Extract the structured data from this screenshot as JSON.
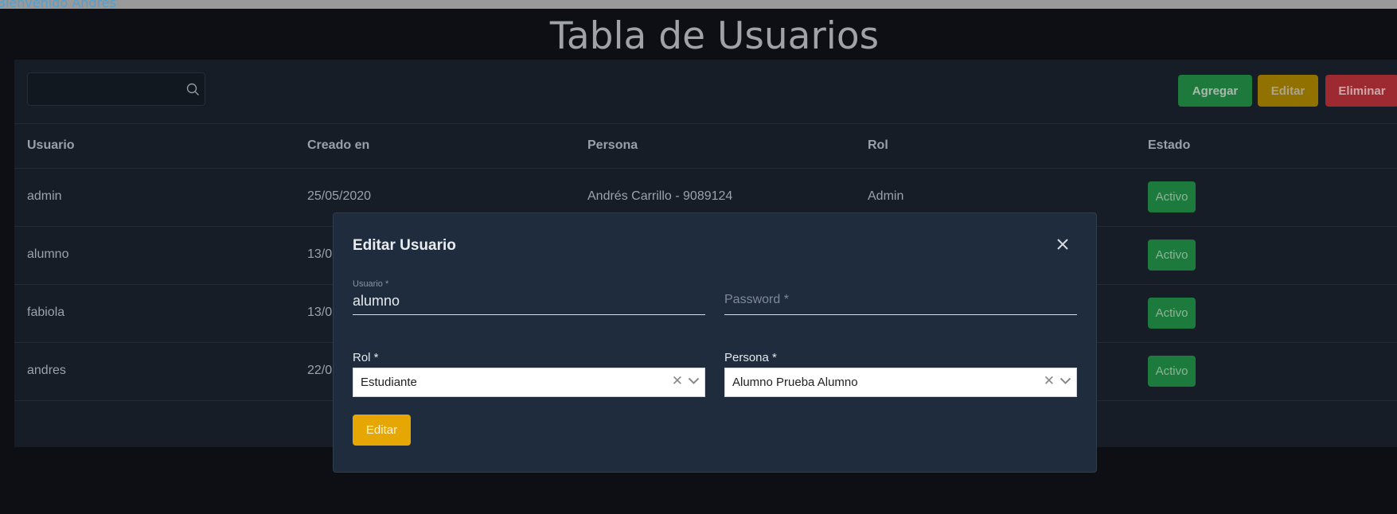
{
  "topbar": {
    "text": "Bienvenido Andres"
  },
  "page": {
    "title": "Tabla de Usuarios"
  },
  "toolbar": {
    "search_placeholder": "",
    "add_label": "Agregar",
    "edit_label": "Editar",
    "delete_label": "Eliminar"
  },
  "table": {
    "headers": {
      "usuario": "Usuario",
      "creado": "Creado en",
      "persona": "Persona",
      "rol": "Rol",
      "estado": "Estado"
    },
    "rows": [
      {
        "usuario": "admin",
        "creado": "25/05/2020",
        "persona": "Andrés Carrillo - 9089124",
        "rol": "Admin",
        "estado": "Activo"
      },
      {
        "usuario": "alumno",
        "creado": "13/0",
        "persona": "",
        "rol": "",
        "estado": "Activo"
      },
      {
        "usuario": "fabiola",
        "creado": "13/0",
        "persona": "",
        "rol": "",
        "estado": "Activo"
      },
      {
        "usuario": "andres",
        "creado": "22/0",
        "persona": "",
        "rol": "",
        "estado": "Activo"
      }
    ]
  },
  "modal": {
    "title": "Editar Usuario",
    "usuario_label": "Usuario *",
    "usuario_value": "alumno",
    "password_placeholder": "Password *",
    "rol_label": "Rol *",
    "rol_value": "Estudiante",
    "persona_label": "Persona *",
    "persona_value": "Alumno Prueba Alumno",
    "submit_label": "Editar"
  },
  "colors": {
    "background": "#0d0f14",
    "panel": "#161d27",
    "modal": "#1f2c3e",
    "success": "#1d7a3c",
    "warning": "#917200",
    "danger": "#9c2a30",
    "accent": "#e6a705"
  },
  "icons": {
    "search": "search-icon",
    "close": "close-icon",
    "clear": "clear-icon",
    "chevron": "chevron-down-icon"
  }
}
